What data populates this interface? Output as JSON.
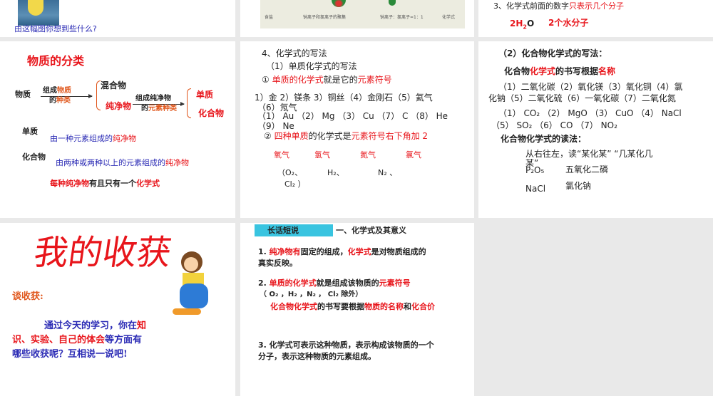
{
  "slides": [
    {
      "caption": "由这幅图你想到些什么?"
    },
    {
      "labels": [
        "食盐",
        "钠离子和氯离子的聚集",
        "钠离子：氯离子=1：1",
        "化学式"
      ]
    },
    {
      "line1": [
        {
          "t": "3、化学式前面的数字",
          "c": "k"
        },
        {
          "t": "只表示几个分子",
          "c": "r"
        }
      ],
      "formula": "2H",
      "formula_sub": "2",
      "formula_end": "O",
      "meaning": "2个水分子"
    },
    {
      "title": "物质的分类",
      "root": "物质",
      "arrow1_top": [
        {
          "t": "组成",
          "c": "k"
        },
        {
          "t": "物质",
          "c": "o"
        }
      ],
      "arrow1_bottom": [
        {
          "t": "的",
          "c": "k"
        },
        {
          "t": "种类",
          "c": "o"
        }
      ],
      "mixture": "混合物",
      "pure": "纯净物",
      "arrow2_top": "组成纯净物",
      "arrow2_bottom": [
        {
          "t": "的",
          "c": "k"
        },
        {
          "t": "元素种类",
          "c": "o"
        }
      ],
      "element": "单质",
      "compound": "化合物",
      "def1_term": "单质",
      "def1": [
        {
          "t": "由一种元素组成的",
          "c": "bl"
        },
        {
          "t": "纯净物",
          "c": "r"
        }
      ],
      "def2_term": "化合物",
      "def2": [
        {
          "t": "由两种或两种以上的元素组成的",
          "c": "bl"
        },
        {
          "t": "纯净物",
          "c": "r"
        }
      ],
      "summary": [
        {
          "t": "每种纯净物",
          "c": "r"
        },
        {
          "t": "有且只有一个",
          "c": "k"
        },
        {
          "t": "化学式",
          "c": "r"
        }
      ]
    },
    {
      "h1": "4、化学式的写法",
      "h2": "（1）单质化学式的写法",
      "p1": [
        {
          "t": "① ",
          "c": "k"
        },
        {
          "t": "单质的化学式",
          "c": "r"
        },
        {
          "t": "就是它的",
          "c": "k"
        },
        {
          "t": "元素符号",
          "c": "r"
        }
      ],
      "list1": "1）金  2）镁条  3）铜丝（4）金刚石（5）氦气",
      "list2": "（6）氖气",
      "list3": "（1） Au （2） Mg （3） Cu （7） C （8） He",
      "list4": "（9） Ne",
      "p2": [
        {
          "t": "② ",
          "c": "k"
        },
        {
          "t": "四种单质",
          "c": "r"
        },
        {
          "t": "的化学式是",
          "c": "k"
        },
        {
          "t": "元素符号右下角加 2",
          "c": "r"
        }
      ],
      "gases": [
        "氧气",
        "氢气",
        "氮气",
        "氯气"
      ],
      "f1": "（O₂、",
      "f2": "H₂、",
      "f3": "N₂ 、",
      "f4": "Cl₂ ）"
    },
    {
      "h1": "（2）化合物化学式的写法：",
      "p1": [
        {
          "t": "化合物",
          "c": "k"
        },
        {
          "t": "化学式",
          "c": "r"
        },
        {
          "t": "的书写根据",
          "c": "k"
        },
        {
          "t": "名称",
          "c": "r"
        }
      ],
      "l1": "（1）二氧化碳（2）氧化镁（3）氧化铜（4）氯",
      "l2": "化钠（5）二氧化硫（6）一氧化碳（7）二氧化氮",
      "l3": "（1） CO₂ （2） MgO （3） CuO （4） NaCl",
      "l4": "（5） SO₂ （6） CO （7） NO₂",
      "h2": "化合物化学式的读法：",
      "rule1": "从右往左，读“某化某”  “几某化几",
      "rule2": "某”",
      "ex1f": "P₂O₅",
      "ex1n": "五氧化二磷",
      "ex2f": "NaCl",
      "ex2n": "氯化钠"
    },
    {
      "title": "我的收获",
      "sub": "谈收获:",
      "body1": [
        {
          "t": "通过今天的学习，你在",
          "c": "bl"
        },
        {
          "t": "知",
          "c": "r"
        }
      ],
      "body2": [
        {
          "t": "识、实验、自己的体会",
          "c": "r"
        },
        {
          "t": "等方面有",
          "c": "bl"
        }
      ],
      "body3": [
        {
          "t": "哪些收获呢？互相说一说吧!",
          "c": "bl"
        }
      ]
    },
    {
      "tag": "长话短说",
      "heading": "一、化学式及其意义",
      "p1a": [
        {
          "t": "1. ",
          "c": "k"
        },
        {
          "t": "纯净物有",
          "c": "r"
        },
        {
          "t": "固定的组成，",
          "c": "k"
        },
        {
          "t": "化学式",
          "c": "r"
        },
        {
          "t": "是对物质组成的",
          "c": "k"
        }
      ],
      "p1b": "真实反映。",
      "p2a": [
        {
          "t": "2. ",
          "c": "k"
        },
        {
          "t": "单质的化学式",
          "c": "r"
        },
        {
          "t": "就是组成该物质的",
          "c": "k"
        },
        {
          "t": "元素符号",
          "c": "r"
        }
      ],
      "p2b": "（  O₂ ，H₂ ，N₂ ， Cl₂ 除外）",
      "p2c": [
        {
          "t": "化合物化学式",
          "c": "r"
        },
        {
          "t": "的书写要根据",
          "c": "k"
        },
        {
          "t": "物质的名称",
          "c": "r"
        },
        {
          "t": "和",
          "c": "k"
        },
        {
          "t": "化合价",
          "c": "r"
        }
      ],
      "p3a": "3. 化学式可表示这种物质，表示构成该物质的一个",
      "p3b": "分子，表示这种物质的元素组成。"
    }
  ]
}
